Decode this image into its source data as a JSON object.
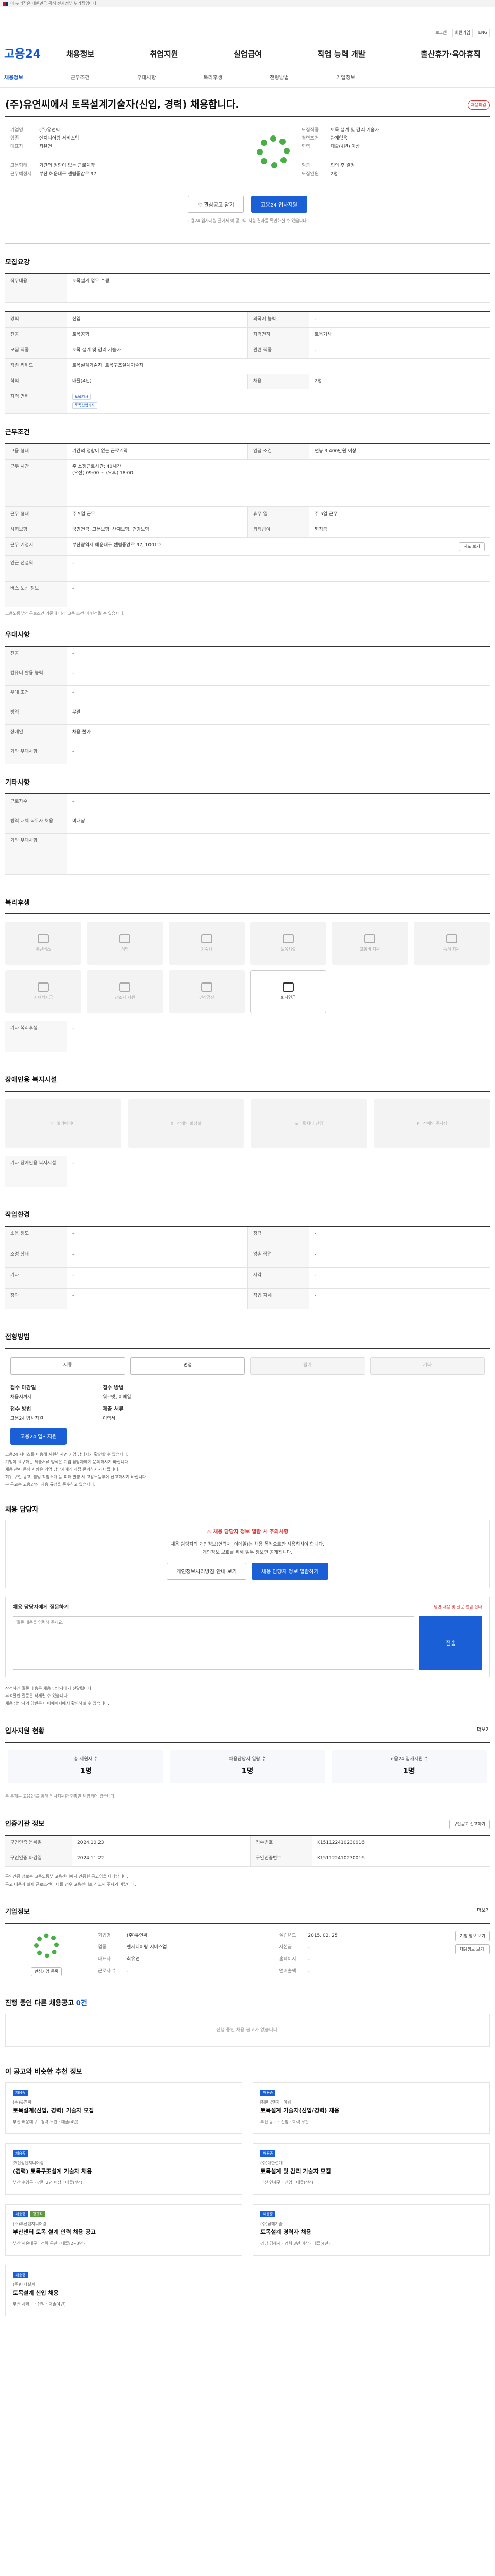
{
  "gov_banner": "이 누리집은 대한민국 공식 전자정부 누리집입니다.",
  "util": [
    "로그인",
    "회원가입",
    "ENG"
  ],
  "gnb": {
    "logo": "고용24",
    "menu": [
      "채용정보",
      "취업지원",
      "실업급여",
      "직업 능력 개발",
      "출산휴가·육아휴직"
    ]
  },
  "subnav": [
    "채용정보",
    "근무조건",
    "우대사항",
    "복리후생",
    "전형방법",
    "기업정보"
  ],
  "job": {
    "title": "(주)유연씨에서 토목설계기술자(신입, 경력) 채용합니다.",
    "badge": "채용마감",
    "left": [
      [
        "기업명",
        "(주)유연씨"
      ],
      [
        "업종",
        "엔지니어링 서비스업"
      ],
      [
        "대표자",
        "최유연"
      ]
    ],
    "left2": [
      [
        "고용형태",
        "기간의 정함이 없는 근로계약"
      ],
      [
        "근무예정지",
        "부산 해운대구 센텀중앙로 97"
      ]
    ],
    "right": [
      [
        "모집직종",
        "토목 설계 및 감리 기술자"
      ],
      [
        "경력조건",
        "관계없음"
      ],
      [
        "학력",
        "대졸(4년) 이상"
      ]
    ],
    "right2": [
      [
        "임금",
        "협의 후 결정"
      ],
      [
        "모집인원",
        "2명"
      ]
    ],
    "btn_save": "관심공고 담기",
    "btn_apply": "고용24 입사지원",
    "notice": "고용24 입사지원 글에서 이 공고의 지원 결과를 확인하실 수 있습니다."
  },
  "s_recruit": {
    "title": "모집요강",
    "rows": [
      [
        "직무내용",
        "토목설계 업무 수행",
        "",
        ""
      ]
    ]
  },
  "s_qual": {
    "rows": [
      [
        [
          "경력",
          "신입"
        ],
        [
          "외국어 능력",
          "-"
        ]
      ],
      [
        [
          "전공",
          "토목공학"
        ],
        [
          "자격면허",
          "토목기사"
        ]
      ],
      [
        [
          "모집 직종",
          "토목 설계 및 감리 기술자"
        ],
        [
          "관련 직종",
          "-"
        ]
      ],
      [
        [
          "직종 키워드",
          "토목설계기술자, 토목구조설계기술자"
        ],
        [
          "",
          ""
        ]
      ],
      [
        [
          "학력",
          "대졸(4년)"
        ],
        [
          "채용",
          "2명"
        ]
      ]
    ],
    "chips": [
      "토목기사",
      "토목산업기사"
    ]
  },
  "s_cond": {
    "title": "근무조건",
    "rows": [
      [
        [
          "고용 형태",
          "기간의 정함이 없는 근로계약"
        ],
        [
          "임금 조건",
          "연봉 3,400만원 이상"
        ]
      ],
      [
        [
          "",
          "주 소정근로시간: 40시간"
        ],
        [
          "",
          ""
        ]
      ],
      [
        [
          "근무 시간",
          "(오전) 09:00 ~ (오후) 18:00"
        ],
        [
          "",
          ""
        ]
      ],
      [
        [
          "근무 형태",
          "주 5일 근무"
        ],
        [
          "휴무 일",
          "주 5일 근무"
        ]
      ],
      [
        [
          "사회보험",
          "국민연금, 고용보험, 산재보험, 건강보험"
        ],
        [
          "퇴직급여",
          "퇴직금"
        ]
      ],
      [
        [
          "근무 예정지",
          "부산광역시 해운대구 센텀중앙로 97, 1001호"
        ],
        [
          "",
          ""
        ]
      ],
      [
        [
          "인근 전철역",
          "-"
        ],
        [
          "",
          ""
        ]
      ],
      [
        [
          "버스 노선 정보",
          "-"
        ],
        [
          "",
          ""
        ]
      ]
    ],
    "map_btn": "지도 보기",
    "note": "고용노동부의 근로조건 기준에 따라 고용 조건 이 변경될 수 있습니다."
  },
  "s_pref": {
    "title": "우대사항",
    "rows": [
      [
        "전공",
        "-"
      ],
      [
        "컴퓨터 활용 능력",
        "-"
      ],
      [
        "우대 조건",
        "-"
      ],
      [
        "병역",
        "무관"
      ],
      [
        "장애인",
        "채용 불가"
      ],
      [
        "기타 우대사항",
        "-"
      ]
    ]
  },
  "s_etc": {
    "title": "기타사항",
    "rows": [
      [
        "근로자수",
        "-"
      ],
      [
        "병역 대체 복무자 채용",
        "비대상"
      ],
      [
        "기타 우대사항",
        ""
      ]
    ]
  },
  "s_welfare": {
    "title": "복리후생",
    "cards": [
      {
        "icon": "car-icon",
        "label": "통근버스",
        "on": false
      },
      {
        "icon": "food-icon",
        "label": "식당",
        "on": false
      },
      {
        "icon": "house-icon",
        "label": "기숙사",
        "on": false
      },
      {
        "icon": "baby-icon",
        "label": "보육시설",
        "on": false
      },
      {
        "icon": "car-pass-icon",
        "label": "교통비 지원",
        "on": false
      },
      {
        "icon": "meal-icon",
        "label": "중식 지원",
        "on": false
      },
      {
        "icon": "family-icon",
        "label": "자녀학자금",
        "on": false
      },
      {
        "icon": "gift-icon",
        "label": "경조사 지원",
        "on": false
      },
      {
        "icon": "health-icon",
        "label": "건강검진",
        "on": false
      },
      {
        "icon": "leave-icon",
        "label": "퇴직연금",
        "on": true
      }
    ],
    "etc_label": "기타 복리후생",
    "etc_value": "-"
  },
  "s_disab": {
    "title": "장애인용 복지시설",
    "cards": [
      "엘리베이터",
      "장애인 화장실",
      "휠체어 진입",
      "장애인 주차장"
    ],
    "etc_label": "기타 장애인용 복지시설",
    "etc_value": "-"
  },
  "s_work": {
    "title": "작업환경",
    "rows": [
      [
        [
          "소음 정도",
          "-"
        ],
        [
          "청력",
          "-"
        ]
      ],
      [
        [
          "조명 상태",
          "-"
        ],
        [
          "양손 작업",
          "-"
        ]
      ],
      [
        [
          "기타",
          "-"
        ],
        [
          "시각",
          "-"
        ]
      ],
      [
        [
          "청각",
          "-"
        ],
        [
          "작업 자세",
          "-"
        ]
      ]
    ]
  },
  "s_proc": {
    "title": "전형방법",
    "steps": [
      {
        "label": "서류",
        "dim": false
      },
      {
        "label": "면접",
        "dim": false
      },
      {
        "label": "필기",
        "dim": true
      },
      {
        "label": "기타",
        "dim": true
      }
    ],
    "col1": [
      [
        "접수 마감일",
        "채용시까지"
      ],
      [
        "접수 방법",
        "고용24 입사지원"
      ]
    ],
    "col2": [
      [
        "접수 방법",
        "워크넷, 이메일"
      ],
      [
        "제출 서류",
        "이력서"
      ]
    ],
    "apply_btn": "고용24 입사지원",
    "bullets": [
      "고용24 서비스를 이용해 지원하시면 기업 담당자가 확인할 수 있습니다.",
      "기업이 요구하는 제출서류 양식은 기업 담당자에게 문의하시기 바랍니다.",
      "채용 관련 문의 사항은 기업 담당자에게 직접 문의하시기 바랍니다.",
      "허위 구인 광고, 불법 직업소개 등 피해 발생 시 고용노동부에 신고하시기 바랍니다.",
      "본 공고는 고용24의 채용 규정을 준수하고 있습니다."
    ]
  },
  "s_contact": {
    "title": "채용 담당자",
    "h": "채용 담당자 정보 열람 시 주의사항",
    "p": [
      "채용 담당자의 개인정보(연락처, 이메일)는 채용 목적으로만 사용하셔야 합니다.",
      "개인정보 보호를 위해 일부 정보만 공개됩니다."
    ],
    "btn1": "개인정보처리방침 안내 보기",
    "btn2": "채용 담당자 정보 열람하기",
    "ask_title": "채용 담당자에게 질문하기",
    "ask_warn": "답변 내용 및 질문 열람 안내",
    "ask_placeholder": "질문 내용을 입력해 주세요.",
    "ask_btn": "전송",
    "notes": [
      "작성하신 질문 내용은 채용 담당자에게 전달됩니다.",
      "부적절한 질문은 삭제될 수 있습니다.",
      "채용 담당자의 답변은 마이페이지에서 확인하실 수 있습니다."
    ]
  },
  "s_stats": {
    "title": "입사지원 현황",
    "more": "더보기",
    "items": [
      [
        "총 지원자 수",
        "1명"
      ],
      [
        "채용담당자 열람 수",
        "1명"
      ],
      [
        "고용24 입사지원 수",
        "1명"
      ]
    ],
    "note": "본 통계는 고용24를 통해 입사지원한 현황만 반영되어 있습니다."
  },
  "s_info": {
    "title": "인증기관 정보",
    "btn": "구인공고 신고하기",
    "rows": [
      [
        [
          "구인인증 등록일",
          "2024.10.23"
        ],
        [
          "접수번호",
          "K151122410230016"
        ]
      ],
      [
        [
          "구인인증 마감일",
          "2024.11.22"
        ],
        [
          "구인인증번호",
          "K151122410230016"
        ]
      ]
    ],
    "notes": [
      "구인인증 정보는 고용노동부 고용센터에서 인증한 공고임을 나타냅니다.",
      "공고 내용과 실제 근로조건이 다를 경우 고용센터로 신고해 주시기 바랍니다."
    ]
  },
  "s_corp": {
    "title": "기업정보",
    "more": "더보기",
    "rows": [
      [
        "기업명",
        "(주)유연씨"
      ],
      [
        "업종",
        "엔지니어링 서비스업"
      ],
      [
        "대표자",
        "최유연"
      ],
      [
        "설립년도",
        "2015. 02. 25"
      ],
      [
        "자본금",
        "-"
      ],
      [
        "홈페이지",
        "-"
      ],
      [
        "근로자 수",
        "-"
      ],
      [
        "연매출액",
        "-"
      ]
    ],
    "btn1": "관심기업 등록",
    "btn2": "기업 정보 보기",
    "btn3": "채용정보 보기"
  },
  "s_other": {
    "title": "진행 중인 다른 채용공고",
    "count": "0건",
    "empty": "진행 중인 채용 공고가 없습니다."
  },
  "s_rec": {
    "title": "이 공고와 비슷한 추천 정보",
    "items": [
      {
        "tags": [
          "채용중"
        ],
        "company": "(주)유연씨",
        "title": "토목설계(신입, 경력) 기술자 모집",
        "meta": [
          "부산 해운대구",
          "경력 무관",
          "대졸(4년)"
        ]
      },
      {
        "tags": [
          "채용중"
        ],
        "company": "㈜한국엔지니어링",
        "title": "토목설계 기술자(신입/경력) 채용",
        "meta": [
          "부산 동구",
          "신입",
          "학력 무관"
        ]
      },
      {
        "tags": [
          "채용중"
        ],
        "company": "㈜신성엔지니어링",
        "title": "(경력) 토목구조설계 기술자 채용",
        "meta": [
          "부산 수영구",
          "경력 2년 이상",
          "대졸(4년)"
        ]
      },
      {
        "tags": [
          "채용중"
        ],
        "company": "(주)대한설계",
        "title": "토목설계 및 감리 기술자 모집",
        "meta": [
          "부산 연제구",
          "신입",
          "대졸(4년)"
        ]
      },
      {
        "tags": [
          "채용중",
          "정규직"
        ],
        "company": "(주)부산엔지니어링",
        "title": "부산센터 토목 설계 인력 채용 공고",
        "meta": [
          "부산 해운대구",
          "경력 무관",
          "대졸(2~3년)"
        ]
      },
      {
        "tags": [
          "채용중"
        ],
        "company": "(주)남해기술",
        "title": "토목설계 경력자 채용",
        "meta": [
          "경남 김해시",
          "경력 3년 이상",
          "대졸(4년)"
        ]
      },
      {
        "tags": [
          "채용중"
        ],
        "company": "(주)바다설계",
        "title": "토목설계 신입 채용",
        "meta": [
          "부산 사하구",
          "신입",
          "대졸(4년)"
        ]
      }
    ]
  }
}
